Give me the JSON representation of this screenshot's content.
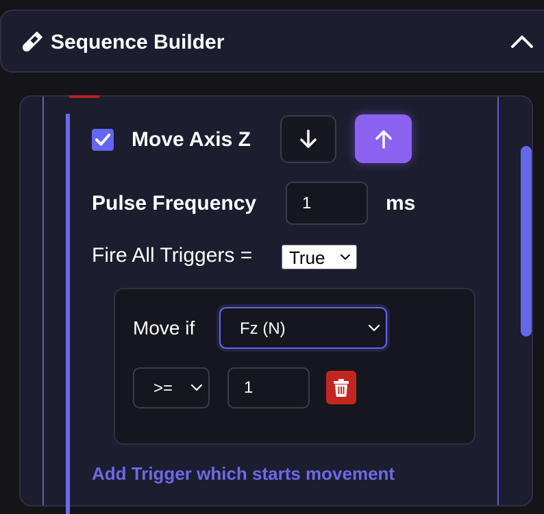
{
  "header": {
    "title": "Sequence Builder",
    "title_icon": "test-tube-icon",
    "collapse_icon": "chevron-up-icon"
  },
  "step": {
    "checked": true,
    "title": "Move Axis Z",
    "direction_down_icon": "arrow-down-icon",
    "direction_up_icon": "arrow-up-icon",
    "selected_direction": "up",
    "pulse_label": "Pulse Frequency",
    "pulse_value": "1",
    "pulse_unit": "ms",
    "fire_label": "Fire All Triggers =",
    "fire_value": "True"
  },
  "trigger": {
    "move_if_label": "Move if",
    "signal_value": "Fz (N)",
    "operator_value": ">=",
    "threshold_value": "1",
    "delete_icon": "trash-icon"
  },
  "add_trigger_label": "Add Trigger which starts movement",
  "colors": {
    "accent": "#6366f1",
    "direction_active": "#8b63f0",
    "delete": "#c1271f",
    "background": "#1c1d2e"
  }
}
